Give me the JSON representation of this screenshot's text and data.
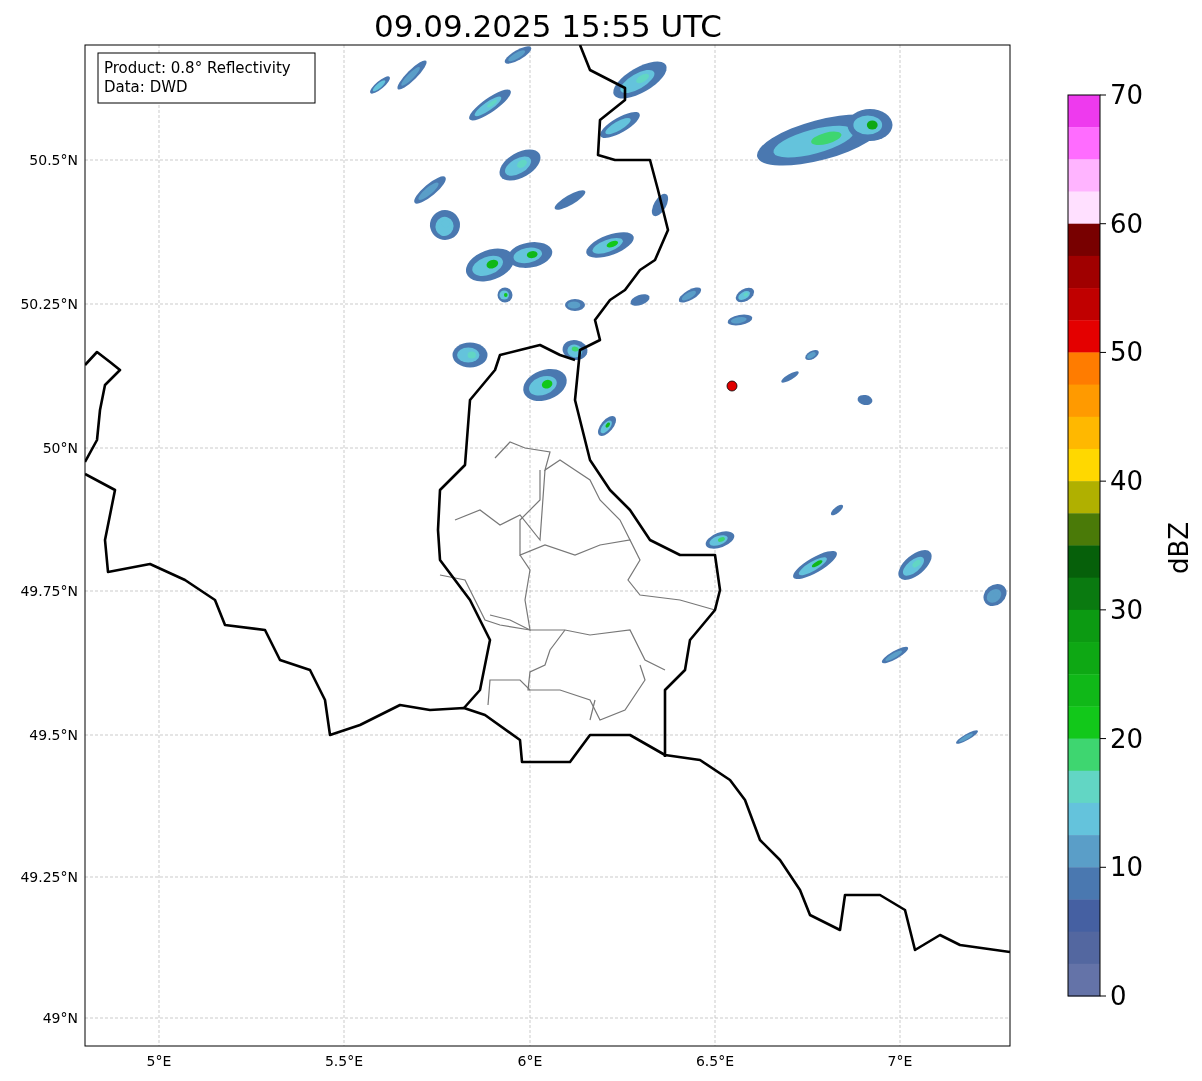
{
  "title": "09.09.2025 15:55 UTC",
  "info_box": {
    "lines": [
      "Product: 0.8° Reflectivity",
      "Data: DWD"
    ]
  },
  "x_ticks": [
    "5°E",
    "5.5°E",
    "6°E",
    "6.5°E",
    "7°E"
  ],
  "y_ticks": [
    "50.5°N",
    "50.25°N",
    "50°N",
    "49.75°N",
    "49.5°N",
    "49.25°N",
    "49°N"
  ],
  "colorbar": {
    "label": "dBZ",
    "ticks": [
      "70",
      "60",
      "50",
      "40",
      "30",
      "20",
      "10",
      "0"
    ],
    "bins": [
      {
        "color": "#ee3aee"
      },
      {
        "color": "#ff6cff"
      },
      {
        "color": "#ffb4ff"
      },
      {
        "color": "#ffe0ff"
      },
      {
        "color": "#780000"
      },
      {
        "color": "#a00000"
      },
      {
        "color": "#c00000"
      },
      {
        "color": "#e40000"
      },
      {
        "color": "#ff7c00"
      },
      {
        "color": "#ff9a00"
      },
      {
        "color": "#ffb800"
      },
      {
        "color": "#ffd800"
      },
      {
        "color": "#b0b000"
      },
      {
        "color": "#4a7a08"
      },
      {
        "color": "#06600a"
      },
      {
        "color": "#0a7a10"
      },
      {
        "color": "#0c9a12"
      },
      {
        "color": "#0ea814"
      },
      {
        "color": "#10b818"
      },
      {
        "color": "#12c81a"
      },
      {
        "color": "#3ed670"
      },
      {
        "color": "#62d6c4"
      },
      {
        "color": "#64c3dc"
      },
      {
        "color": "#5a9ec8"
      },
      {
        "color": "#4a78b0"
      },
      {
        "color": "#4560a2"
      },
      {
        "color": "#5367a0"
      },
      {
        "color": "#6473a8"
      }
    ]
  }
}
